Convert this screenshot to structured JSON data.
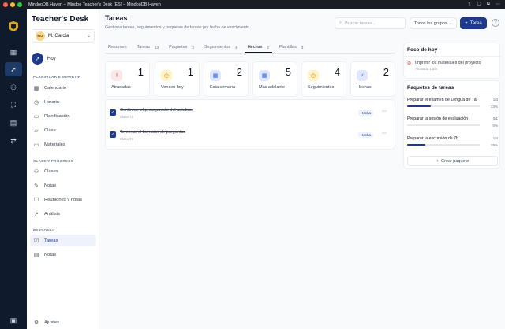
{
  "window": {
    "title": "MindooDB Haven – Mindoo Teacher's Desk (ES) – MindooDB Haven"
  },
  "sidebar": {
    "brand": "Teacher's Desk",
    "user": {
      "initials": "MG",
      "name": "M. García"
    },
    "home": "Hoy",
    "sections": [
      {
        "title": "PLANIFICAR E IMPARTIR"
      },
      {
        "title": "CLASE Y PROGRESO"
      },
      {
        "title": "PERSONAL"
      }
    ],
    "items": [
      {
        "label": "Calendario"
      },
      {
        "label": "Horario"
      },
      {
        "label": "Planificación"
      },
      {
        "label": "Clase"
      },
      {
        "label": "Materiales"
      },
      {
        "label": "Clases"
      },
      {
        "label": "Notas"
      },
      {
        "label": "Reuniones y notas"
      },
      {
        "label": "Análisis"
      },
      {
        "label": "Tareas"
      },
      {
        "label": "Notas"
      }
    ],
    "settings": "Ajustes"
  },
  "header": {
    "title": "Tareas",
    "subtitle": "Gestiona tareas, seguimientos y paquetes de tareas por fecha de vencimiento.",
    "search_placeholder": "Buscar tareas...",
    "group_select": "Todos los grupos",
    "add_label": "Tarea",
    "help": "?"
  },
  "tabs": [
    {
      "label": "Resumen",
      "count": ""
    },
    {
      "label": "Tareas",
      "count": "13"
    },
    {
      "label": "Paquetes",
      "count": "3"
    },
    {
      "label": "Seguimientos",
      "count": "4"
    },
    {
      "label": "Hechas",
      "count": "2"
    },
    {
      "label": "Plantillas",
      "count": "3"
    }
  ],
  "stats": [
    {
      "label": "Atrasadas",
      "value": "1",
      "color": "#dc2626",
      "bg": "#fde8e8",
      "icon": "alert-icon"
    },
    {
      "label": "Vencen hoy",
      "value": "1",
      "color": "#d97706",
      "bg": "#fef3c7",
      "icon": "clock-icon"
    },
    {
      "label": "Esta semana",
      "value": "2",
      "color": "#2563eb",
      "bg": "#e0e7ff",
      "icon": "calendar-icon"
    },
    {
      "label": "Más adelante",
      "value": "5",
      "color": "#2563eb",
      "bg": "#e0e7ff",
      "icon": "calendar-icon"
    },
    {
      "label": "Seguimientos",
      "value": "4",
      "color": "#d97706",
      "bg": "#fef3c7",
      "icon": "clock-icon"
    },
    {
      "label": "Hechas",
      "value": "2",
      "color": "#2563eb",
      "bg": "#e0e7ff",
      "icon": "check-circle-icon"
    }
  ],
  "tasks": [
    {
      "title": "Confirmar el presupuesto del autobús",
      "class": "Clase 7b",
      "status": "Hecha"
    },
    {
      "title": "Terminar el borrador de preguntas",
      "class": "Clase 7a",
      "status": "Hecha"
    }
  ],
  "focus": {
    "title": "Foco de hoy",
    "item": "Imprimir los materiales del proyecto",
    "meta": "Atrasada 1 día"
  },
  "packages": {
    "title": "Paquetes de tareas",
    "items": [
      {
        "name": "Preparar el examen de Lengua de 7a",
        "count": "1/3",
        "percent_text": "33%",
        "progress": 0.33
      },
      {
        "name": "Preparar la sesión de evaluación",
        "count": "0/1",
        "percent_text": "0%",
        "progress": 0
      },
      {
        "name": "Preparar la excursión de 7b",
        "count": "1/4",
        "percent_text": "25%",
        "progress": 0.25
      }
    ],
    "create_label": "Crear paquete"
  },
  "colors": {
    "accent": "#1e3a8a",
    "rail": "#0f1b2d"
  }
}
